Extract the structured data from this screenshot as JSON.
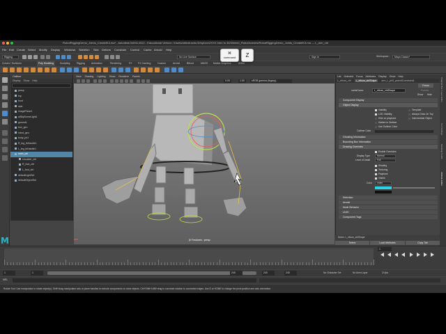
{
  "window": {
    "title": "RobotRiggingDemo_Joints_CreateIK3.ma* - Autodesk MAYA 2022 - Educational Version: /Users/artinstructor/Dropbox/ZXXX Intro to 3D/Week2_Robot/scenes/RobotRiggingDemo_Joints_CreateIK3.ma --- L_arm_ctrl"
  },
  "menus": [
    "File",
    "Edit",
    "Create",
    "Select",
    "Modify",
    "Display",
    "Windows",
    "Skeleton",
    "Skin",
    "Deform",
    "Constrain",
    "Control",
    "Cache",
    "Arnold",
    "Help"
  ],
  "status_line": {
    "menu_set": "Rigging",
    "live_surface": "No Live Surface",
    "sign_in": "Sign In",
    "workspace_label": "Workspace :",
    "workspace_value": "Maya Classic*"
  },
  "shelf_tabs": [
    "Curves / Surfaces",
    "Poly Modeling",
    "Sculpting",
    "Rigging",
    "Animation",
    "Rendering",
    "FX",
    "FX Caching",
    "Custom",
    "Arnold",
    "Bifrost",
    "MASH",
    "Motion Graphics",
    "XGen"
  ],
  "shelf_active_tab": "Poly Modeling",
  "outliner": {
    "title": "Outliner",
    "menu": [
      "Display",
      "Show",
      "Help"
    ],
    "items": [
      {
        "label": "persp",
        "indent": 0,
        "selected": false
      },
      {
        "label": "top",
        "indent": 0,
        "selected": false
      },
      {
        "label": "front",
        "indent": 0,
        "selected": false
      },
      {
        "label": "side",
        "indent": 0,
        "selected": false
      },
      {
        "label": "imagePlane1",
        "indent": 0,
        "selected": false
      },
      {
        "label": "aiSkyDomeLight1",
        "indent": 0,
        "selected": false
      },
      {
        "label": "ground1",
        "indent": 0,
        "selected": false
      },
      {
        "label": "box_geo",
        "indent": 0,
        "selected": false
      },
      {
        "label": "robot_geo",
        "indent": 0,
        "selected": false
      },
      {
        "label": "body_jnt1",
        "indent": 0,
        "selected": false
      },
      {
        "label": "R_leg_ikHandle1",
        "indent": 0,
        "selected": false
      },
      {
        "label": "L_leg_ikHandle1",
        "indent": 0,
        "selected": false
      },
      {
        "label": "main_ctrl",
        "indent": 0,
        "selected": true
      },
      {
        "label": "shoulder_ctrl",
        "indent": 1,
        "selected": false
      },
      {
        "label": "R_foot_ctrl",
        "indent": 1,
        "selected": false
      },
      {
        "label": "L_foot_ctrl",
        "indent": 1,
        "selected": false
      },
      {
        "label": "defaultLightSet",
        "indent": 0,
        "selected": false
      },
      {
        "label": "defaultObjectSet",
        "indent": 0,
        "selected": false
      }
    ]
  },
  "viewport": {
    "menu": [
      "View",
      "Shading",
      "Lighting",
      "Show",
      "Renderer",
      "Panels"
    ],
    "field_a": "0.00",
    "field_b": "1.00",
    "color_space": "sRGB gamma (legacy)",
    "camera_label": "(0 Fractures : persp"
  },
  "attribute_editor": {
    "tabs": [
      "List",
      "Selected",
      "Focus",
      "Attributes",
      "Display",
      "Show",
      "Help"
    ],
    "nodes": [
      "L_elbow_ctrl",
      "L_elbow_ctrlShape",
      "arm_L_jnt3_parentConstraint1"
    ],
    "type_label": "nurbsCurve:",
    "node_name": "L_elbow_ctrlShape",
    "focus_btn": "Focus",
    "presets_btn": "Presets",
    "show_btn": "Show",
    "hide_btn": "Hide",
    "sections": [
      {
        "label": "Component Display",
        "open": false
      },
      {
        "label": "Object Display",
        "open": true
      },
      {
        "label": "Visibility",
        "check": true,
        "kind": "check"
      },
      {
        "label": "Template",
        "check": false,
        "kind": "check2"
      },
      {
        "label": "LOD Visibility",
        "check": true,
        "kind": "check"
      },
      {
        "label": "Always Draw On Top",
        "check": false,
        "kind": "check2"
      },
      {
        "label": "Hide on playback",
        "check": false,
        "kind": "check"
      },
      {
        "label": "Intermediate Object",
        "check": false,
        "kind": "check2"
      },
      {
        "label": "Hidden in Outliner",
        "check": false,
        "kind": "check"
      },
      {
        "label": "Use Outliner Color",
        "check": false,
        "kind": "check"
      }
    ],
    "outliner_color_label": "Outliner Color",
    "collapsed_sections": [
      "Ghosting Information",
      "Bounding Box Information",
      "Drawing Overrides"
    ],
    "enable_overrides": "Enable Overrides",
    "display_type_label": "Display Type",
    "display_type_value": "Normal",
    "lod_label": "Level of Detail",
    "lod_value": "Full",
    "override_checks": [
      "Shading",
      "Texturing",
      "Playback",
      "Visible"
    ],
    "color_label": "Color",
    "color_value": "Index",
    "override_color": "#27d4e8",
    "lower_sections": [
      "Selection",
      "Arnold",
      "Node Behavior",
      "UUID",
      "Component Tags"
    ],
    "notes_label": "Notes:",
    "notes_node": "L_elbow_ctrlShape",
    "bottom_buttons": [
      "Select",
      "Load Attributes",
      "Copy Tab"
    ]
  },
  "side_tabs": [
    "Channel Box / Layer Editor",
    "Tool Settings",
    "Modeling Toolkit",
    "Attribute Editor"
  ],
  "time_slider": {
    "current_frame": "1",
    "range_start": "1",
    "range_inner_start": "1",
    "range_end": "240",
    "range_inner_end": "240",
    "range_outer_end": "240",
    "character_set": "No Character Set",
    "anim_layer": "No Anim Layer",
    "fps": "24 fps"
  },
  "command_line": {
    "label": "MEL"
  },
  "help_line": "Rotate Tool: Use manipulator to rotate object(s). Shift+drag manipulator axis or plane handles to extrude components or clone objects. Ctrl+Shift+LMB+drag to constrain rotation to connected edges. Use D or HOME to change the pivot position and axis orientation.",
  "keys": {
    "cmd_symbol": "⌘",
    "cmd_label": "command",
    "z_label": "Z"
  },
  "colors": {
    "selection": "#5285a6",
    "maya_logo": "#27b7c9",
    "shelf_orange": "#d48a3a",
    "shelf_blue": "#4f8cc9"
  }
}
